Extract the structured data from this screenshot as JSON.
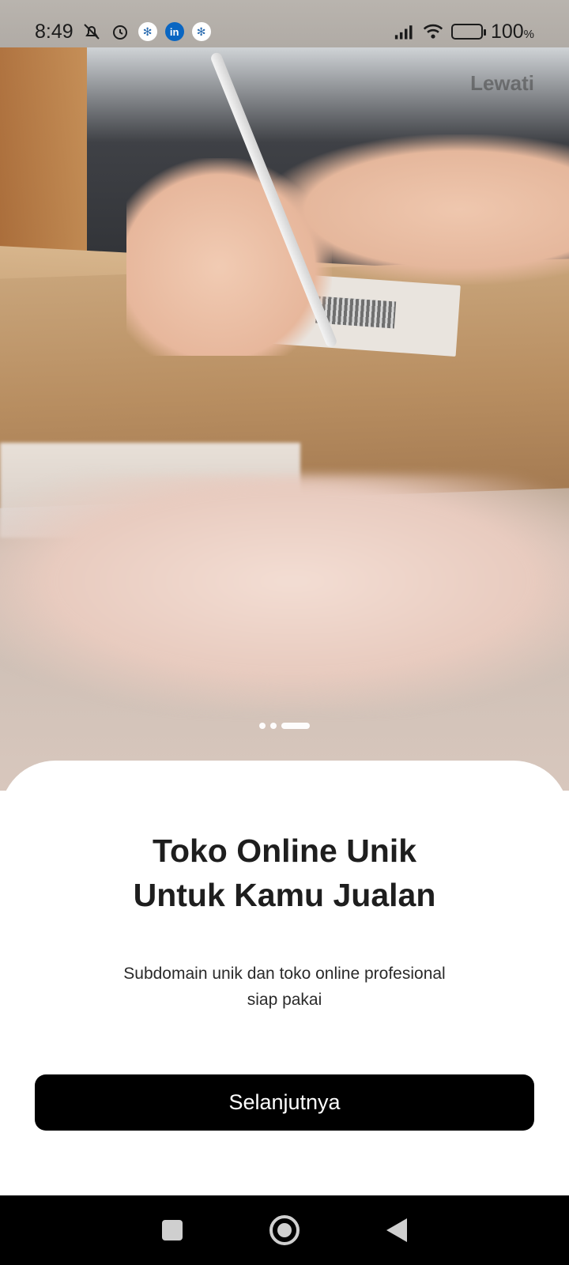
{
  "status_bar": {
    "time": "8:49",
    "battery_percent": "100",
    "battery_unit": "%",
    "icons": [
      "bell-off-icon",
      "alarm-icon",
      "app-icon",
      "linkedin-icon",
      "app-icon",
      "signal-icon",
      "wifi-icon",
      "battery-charging-icon"
    ]
  },
  "header": {
    "skip_label": "Lewati"
  },
  "carousel": {
    "total_pages": 3,
    "active_page": 3
  },
  "onboarding": {
    "title_line1": "Toko Online Unik",
    "title_line2": "Untuk Kamu Jualan",
    "subtitle_line1": "Subdomain unik dan toko online profesional",
    "subtitle_line2": "siap pakai",
    "next_button_label": "Selanjutnya"
  },
  "nav_bar": {
    "buttons": [
      "recents-icon",
      "home-icon",
      "back-icon"
    ]
  },
  "colors": {
    "button_bg": "#000000",
    "button_text": "#ffffff",
    "title_text": "#1e1e1e",
    "sheet_bg": "#ffffff"
  }
}
